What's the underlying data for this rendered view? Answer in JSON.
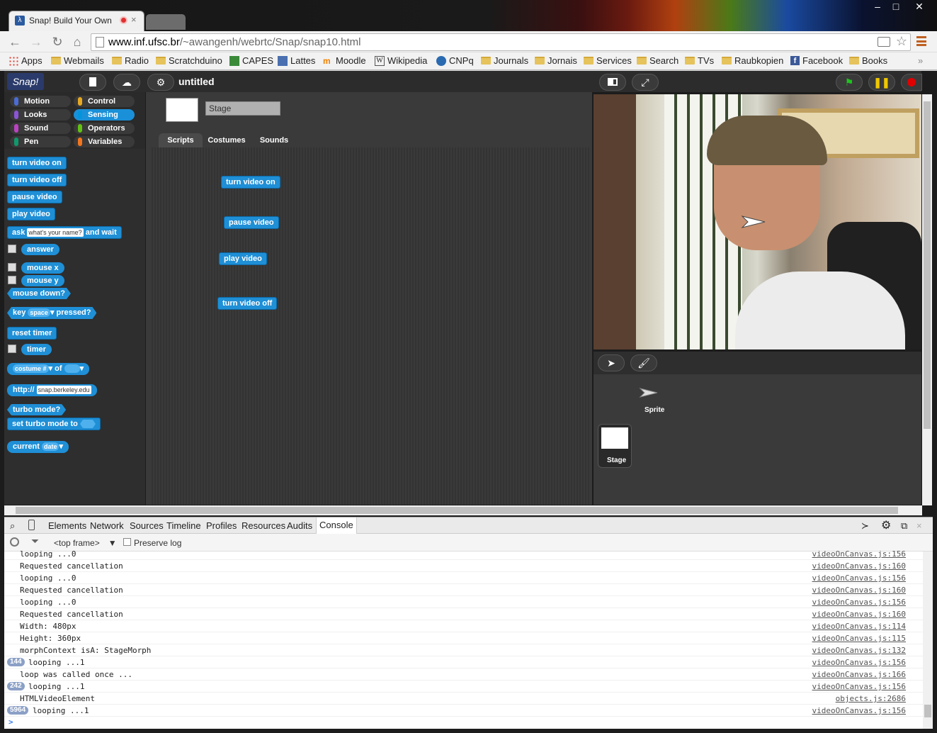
{
  "browser": {
    "tab_title": "Snap! Build Your Own",
    "tab_close": "×",
    "url_domain": "www.inf.ufsc.br",
    "url_path": "/~awangenh/webrtc/Snap/snap10.html",
    "window_controls": [
      "–",
      "□",
      "✕"
    ],
    "bookmarks": [
      "Apps",
      "Webmails",
      "Radio",
      "Scratchduino",
      "CAPES",
      "Lattes",
      "Moodle",
      "Wikipedia",
      "CNPq",
      "Journals",
      "Jornais",
      "Services",
      "Search",
      "TVs",
      "Raubkopien",
      "Facebook",
      "Books"
    ],
    "bookmarks_more": "»"
  },
  "snap": {
    "logo": "Snap!",
    "project_name": "untitled",
    "categories": [
      {
        "label": "Motion",
        "color": "#4a6cd4"
      },
      {
        "label": "Control",
        "color": "#e6a822"
      },
      {
        "label": "Looks",
        "color": "#8a55d7"
      },
      {
        "label": "Sensing",
        "color": "#0494dc"
      },
      {
        "label": "Sound",
        "color": "#bb42c3"
      },
      {
        "label": "Operators",
        "color": "#62c213"
      },
      {
        "label": "Pen",
        "color": "#0e9a6c"
      },
      {
        "label": "Variables",
        "color": "#f3761d"
      }
    ],
    "selected_category": "Sensing",
    "palette": {
      "turn_on": "turn video on",
      "turn_off": "turn video off",
      "pause": "pause video",
      "play": "play video",
      "ask": "ask",
      "ask_default": "what's your name?",
      "and_wait": "and wait",
      "answer": "answer",
      "mouse_x": "mouse x",
      "mouse_y": "mouse y",
      "mouse_down": "mouse down?",
      "key": "key",
      "key_default": "space",
      "pressed": "pressed?",
      "reset_timer": "reset timer",
      "timer": "timer",
      "costume_num": "costume #",
      "of": "of",
      "http": "http://",
      "http_default": "snap.berkeley.edu",
      "turbo_mode": "turbo mode?",
      "set_turbo": "set turbo mode to",
      "current": "current",
      "current_default": "date"
    },
    "sprite_name": "Stage",
    "editor_tabs": [
      "Scripts",
      "Costumes",
      "Sounds"
    ],
    "scripts": [
      "turn video on",
      "pause video",
      "play video",
      "turn video off"
    ],
    "corral": {
      "sprite_label": "Sprite",
      "stage_label": "Stage"
    }
  },
  "devtools": {
    "tabs": [
      "Elements",
      "Network",
      "Sources",
      "Timeline",
      "Profiles",
      "Resources",
      "Audits",
      "Console"
    ],
    "active_tab": "Console",
    "frame": "<top frame>",
    "preserve_log": "Preserve log",
    "prompt": ">",
    "rows": [
      {
        "count": "",
        "msg": "looping ...0",
        "src": "videoOnCanvas.js:156"
      },
      {
        "count": "",
        "msg": "Requested cancellation",
        "src": "videoOnCanvas.js:160"
      },
      {
        "count": "",
        "msg": "looping ...0",
        "src": "videoOnCanvas.js:156"
      },
      {
        "count": "",
        "msg": "Requested cancellation",
        "src": "videoOnCanvas.js:160"
      },
      {
        "count": "",
        "msg": "looping ...0",
        "src": "videoOnCanvas.js:156"
      },
      {
        "count": "",
        "msg": "Requested cancellation",
        "src": "videoOnCanvas.js:160"
      },
      {
        "count": "",
        "msg": "Width: 480px",
        "src": "videoOnCanvas.js:114"
      },
      {
        "count": "",
        "msg": "Height: 360px",
        "src": "videoOnCanvas.js:115"
      },
      {
        "count": "",
        "msg": "morphContext isA: StageMorph",
        "src": "videoOnCanvas.js:132"
      },
      {
        "count": "144",
        "msg": "looping ...1",
        "src": "videoOnCanvas.js:156"
      },
      {
        "count": "",
        "msg": "loop was called once ...",
        "src": "videoOnCanvas.js:166"
      },
      {
        "count": "242",
        "msg": "looping ...1",
        "src": "videoOnCanvas.js:156"
      },
      {
        "count": "",
        "msg": "HTMLVideoElement",
        "src": "objects.js:2686"
      },
      {
        "count": "5964",
        "msg": "looping ...1",
        "src": "videoOnCanvas.js:156"
      }
    ]
  }
}
